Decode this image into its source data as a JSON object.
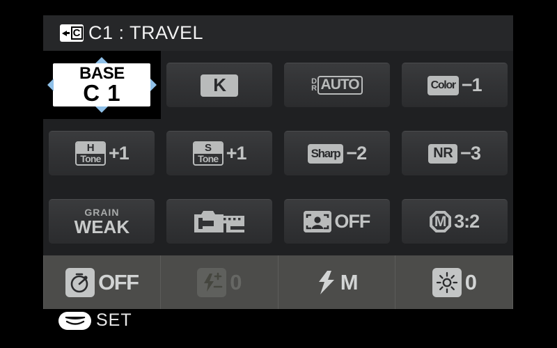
{
  "header": {
    "back_icon": "back-to-c-icon",
    "title": "C1 : TRAVEL"
  },
  "grid": {
    "rows": [
      [
        {
          "name": "base-c1",
          "kind": "selected",
          "line1": "BASE",
          "line2": "C 1",
          "selected": true
        },
        {
          "name": "white-balance",
          "kind": "badge-k",
          "badge": "K",
          "value": ""
        },
        {
          "name": "dynamic-range",
          "kind": "dr",
          "badge_small_top": "D",
          "badge_small_bottom": "R",
          "badge": "AUTO",
          "value": ""
        },
        {
          "name": "color",
          "kind": "badge-value",
          "badge": "Color",
          "value": "−1"
        }
      ],
      [
        {
          "name": "highlight-tone",
          "kind": "tone",
          "badge_top": "H",
          "badge_bottom": "Tone",
          "value": "+1"
        },
        {
          "name": "shadow-tone",
          "kind": "tone",
          "badge_top": "S",
          "badge_bottom": "Tone",
          "value": "+1"
        },
        {
          "name": "sharpness",
          "kind": "badge-value",
          "badge": "Sharp",
          "value": "−2"
        },
        {
          "name": "noise-reduction",
          "kind": "badge-value",
          "badge": "NR",
          "value": "−3"
        }
      ],
      [
        {
          "name": "grain-effect",
          "kind": "grain",
          "line1": "GRAIN",
          "line2": "WEAK"
        },
        {
          "name": "film-simulation",
          "kind": "film-icon",
          "icon": "film-cartridge-icon"
        },
        {
          "name": "face-detection",
          "kind": "face",
          "icon": "face-detect-icon",
          "value": "OFF"
        },
        {
          "name": "image-size",
          "kind": "msize",
          "badge": "M",
          "value": "3:2"
        }
      ]
    ]
  },
  "strip": {
    "items": [
      {
        "name": "self-timer",
        "icon": "self-timer-icon",
        "value": "OFF",
        "dimmed": false
      },
      {
        "name": "flash-compensation",
        "icon": "flash-compensation-icon",
        "value": "0",
        "dimmed": true
      },
      {
        "name": "flash-mode",
        "icon": "flash-bolt-icon",
        "value": "M",
        "dimmed": false
      },
      {
        "name": "screen-brightness",
        "icon": "sun-icon",
        "value": "0",
        "dimmed": false
      }
    ]
  },
  "footer": {
    "dial_icon": "command-dial-icon",
    "label": "SET"
  },
  "colors": {
    "panel_bg": "#1f2022",
    "header_bg": "#262729",
    "tile_bg": "#323335",
    "badge_fg": "#b9bbbb",
    "strip_bg": "#4c4c4a",
    "selection_arrow": "#8fc0e8",
    "selected_tile_bg": "#ffffff"
  }
}
